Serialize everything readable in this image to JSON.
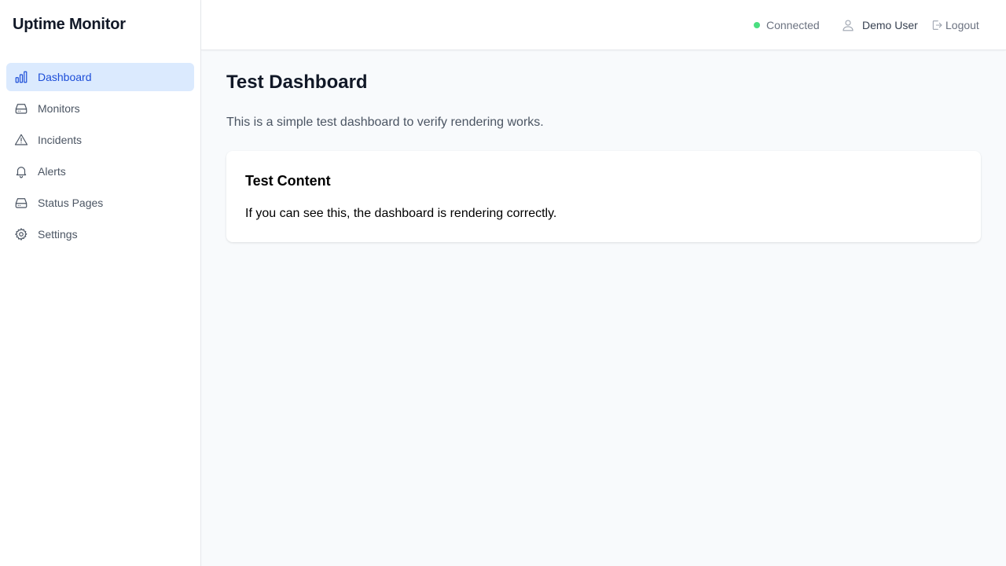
{
  "app": {
    "title": "Uptime Monitor"
  },
  "sidebar": {
    "items": [
      {
        "label": "Dashboard",
        "icon": "bar-chart-icon",
        "active": true
      },
      {
        "label": "Monitors",
        "icon": "hard-drive-icon"
      },
      {
        "label": "Incidents",
        "icon": "alert-triangle-icon"
      },
      {
        "label": "Alerts",
        "icon": "bell-icon"
      },
      {
        "label": "Status Pages",
        "icon": "hard-drive-icon"
      },
      {
        "label": "Settings",
        "icon": "gear-icon"
      }
    ]
  },
  "header": {
    "status": {
      "label": "Connected",
      "color": "#4ade80"
    },
    "user": {
      "name": "Demo User",
      "icon": "user-icon"
    },
    "logout": {
      "label": "Logout",
      "icon": "logout-icon"
    }
  },
  "main": {
    "title": "Test Dashboard",
    "description": "This is a simple test dashboard to verify rendering works.",
    "card": {
      "title": "Test Content",
      "body": "If you can see this, the dashboard is rendering correctly."
    }
  },
  "colors": {
    "accent": "#1d4ed8",
    "accent_bg": "#dbeafe",
    "background": "#f8fafc"
  }
}
